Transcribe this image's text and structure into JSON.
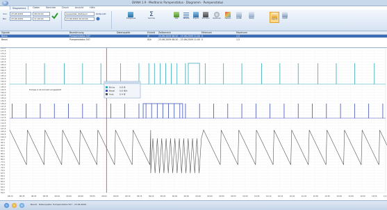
{
  "window": {
    "title": "DIANA 1.9 · Medtronic Pumpenstatus · Diagramm · Pumpenstatus"
  },
  "ribbon_tabs": [
    "Diagramme",
    "Daten",
    "Berichte",
    "Druck",
    "Ansicht",
    "Hilfe"
  ],
  "time_range": {
    "von_label": "Von:",
    "von_date": "23.06.2009",
    "von_time": "08:20:00",
    "bis_label": "Bis:",
    "bis_date": "23.06.2009",
    "bis_time": "11:00:00",
    "timepoint_label": "Zeitpunkt",
    "timepoint_select": "Auswahlen Zeitraum",
    "timepoint_value": "23.06.2009 09:00:00"
  },
  "ribbon_buttons": [
    {
      "label": "Ereignisse"
    },
    {
      "label": "Summe"
    },
    {
      "label": "Alle"
    },
    {
      "label": "Tabelle"
    },
    {
      "label": "Export"
    },
    {
      "label": "Drucken"
    },
    {
      "label": "Optionen"
    },
    {
      "label": "Farben"
    },
    {
      "label": "Grafik"
    },
    {
      "label": "Skala"
    },
    {
      "label": "Layout"
    },
    {
      "label": "Gerät"
    }
  ],
  "signal_table": {
    "section_label": "Signale",
    "headers": [
      "Bezeichnung",
      "Datenquelle",
      "Einheit",
      "Zeitbereich",
      "Minimum",
      "Maximum"
    ],
    "rows": [
      {
        "name": "Bolus",
        "source": "Pumpenstatus 507",
        "unit": "IE",
        "range": "23.06.2009 08:20 - 23.06.2009 11:00",
        "min": "0",
        "max": "2,0"
      },
      {
        "name": "Basal",
        "source": "Pumpenstatus 507",
        "unit": "IE/h",
        "range": "23.06.2009 08:20 - 23.06.2009 11:00",
        "min": "0",
        "max": "1,5"
      }
    ]
  },
  "chart": {
    "annotation": "Pumpe 2 ist korrekt eingestellt",
    "legend_items": [
      {
        "name": "Bolus",
        "value": "0,8 IE"
      },
      {
        "name": "Basal",
        "value": "0,6 IE/h"
      },
      {
        "name": "Ausl.",
        "value": "0,4 IE"
      }
    ],
    "series_colors": {
      "bolus": "#33a8b8",
      "basal": "#4050b0",
      "reservoir": "#555555",
      "cursor": "#d04040"
    }
  },
  "chart_data": {
    "type": "line",
    "y_ticks": [
      "180,0",
      "177,5",
      "175,0",
      "172,5",
      "170,0",
      "167,5",
      "165,0",
      "162,5",
      "160,0",
      "157,5",
      "155,0",
      "152,5",
      "150,0",
      "147,5",
      "145,0",
      "142,5",
      "140,0",
      "137,5",
      "135,0",
      "132,5",
      "130,0",
      "127,5",
      "125,0",
      "122,5",
      "120,0",
      "117,5",
      "115,0",
      "112,5",
      "110,0",
      "107,5",
      "105,0",
      "102,5",
      "100,0",
      "97,5",
      "95,0",
      "92,5",
      "90,0",
      "87,5",
      "85,0",
      "82,5",
      "80,0",
      "77,5",
      "75,0",
      "72,5",
      "70,0",
      "67,5",
      "65,0",
      "62,5",
      "60,0",
      "57,5",
      "55,0",
      "52,5",
      "50,0"
    ],
    "x_ticks": [
      "08:20",
      "08:25",
      "08:30",
      "08:35",
      "08:40",
      "08:45",
      "08:50",
      "08:55",
      "09:00",
      "09:05",
      "09:10",
      "09:15",
      "09:20",
      "09:25",
      "09:30",
      "09:35",
      "09:40",
      "09:45",
      "09:50",
      "09:55",
      "10:00",
      "10:05",
      "10:10",
      "10:15",
      "10:20",
      "10:25",
      "10:30",
      "10:35",
      "10:40",
      "10:45",
      "10:50",
      "10:55",
      "11:00"
    ],
    "series": [
      {
        "name": "Bolus",
        "pulse_times": [
          8.45,
          8.58,
          8.72,
          8.85,
          8.98,
          9.12,
          9.25,
          9.32,
          9.36,
          9.4,
          9.44,
          9.48,
          9.52,
          9.58,
          9.72,
          9.85,
          9.98,
          10.12,
          10.25,
          10.38,
          10.52,
          10.65,
          10.78,
          10.92
        ],
        "block": [
          9.6,
          9.68
        ]
      },
      {
        "name": "Basal",
        "pulse_times": [
          8.35,
          8.45,
          8.55,
          8.65,
          8.75,
          8.85,
          8.95,
          9.05,
          9.15,
          9.25,
          9.3,
          9.34,
          9.38,
          9.42,
          9.46,
          9.5,
          9.54,
          9.58,
          9.68,
          9.78,
          9.88,
          9.98,
          10.08,
          10.18,
          10.28,
          10.38,
          10.48,
          10.58,
          10.68,
          10.78,
          10.88,
          10.98
        ],
        "block": [
          9.28,
          9.56
        ]
      },
      {
        "name": "Ausl.",
        "period_h": 0.125,
        "burst": [
          9.3,
          9.7
        ]
      }
    ],
    "cursor_time": 9.02
  },
  "status": {
    "text": "Bereit · Datenquelle: Pumpenstatus 507 · 23.06.2009"
  }
}
